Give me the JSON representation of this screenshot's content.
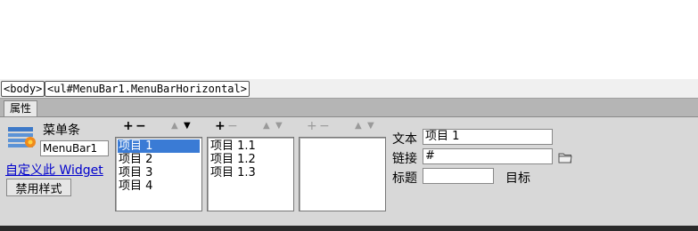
{
  "tag_selector": {
    "body": "<body>",
    "ul": "<ul#MenuBar1.MenuBarHorizontal>"
  },
  "properties_panel": {
    "tab_label": "属性",
    "widget_type": "菜单条",
    "widget_name": "MenuBar1",
    "customize_link": "自定义此 Widget",
    "disable_styles_button": "禁用样式"
  },
  "list_controls": {
    "add": "+",
    "remove": "−",
    "move_up": "▲",
    "move_down": "▼"
  },
  "menu_lists": {
    "level1": [
      "项目 1",
      "项目 2",
      "项目 3",
      "项目 4"
    ],
    "level1_selected": "项目 1",
    "level2": [
      "项目 1.1",
      "项目 1.2",
      "项目 1.3"
    ],
    "level3": []
  },
  "item_properties": {
    "text_label": "文本",
    "text_value": "项目 1",
    "link_label": "链接",
    "link_value": "#",
    "title_label": "标题",
    "title_value": "",
    "target_label": "目标",
    "target_value": ""
  },
  "icons": {
    "menubar": "menubar-widget-icon",
    "browse": "folder-icon"
  }
}
